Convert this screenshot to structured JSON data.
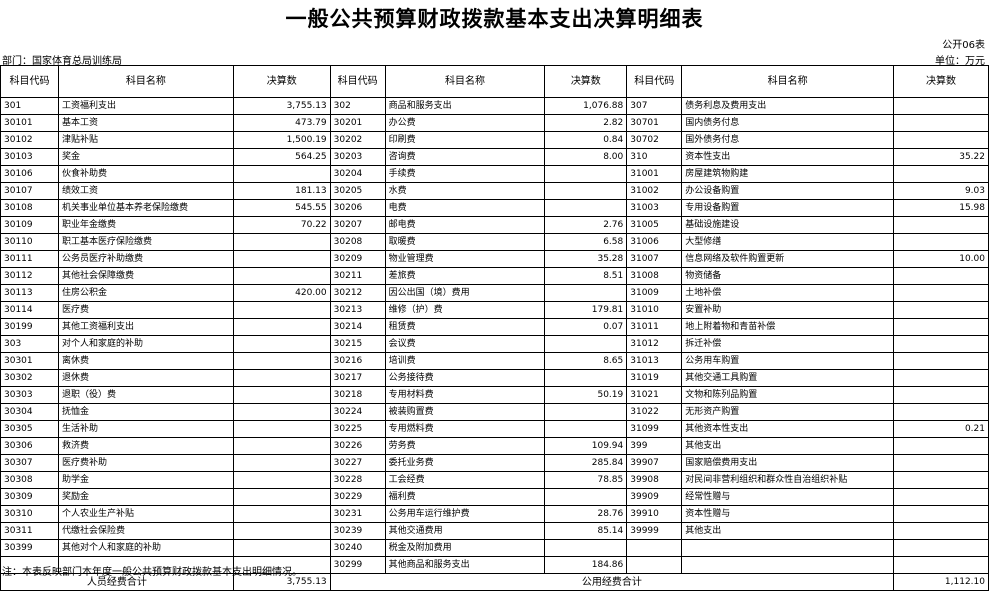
{
  "title": "一般公共预算财政拨款基本支出决算明细表",
  "table_no": "公开06表",
  "department": "部门：国家体育总局训练局",
  "unit": "单位：万元",
  "headers": {
    "code": "科目代码",
    "name": "科目名称",
    "amount": "决算数"
  },
  "rows": [
    {
      "c1": "301",
      "n1": "工资福利支出",
      "a1": "3,755.13",
      "c2": "302",
      "n2": "商品和服务支出",
      "a2": "1,076.88",
      "c3": "307",
      "n3": "债务利息及费用支出",
      "a3": ""
    },
    {
      "c1": "30101",
      "n1": "基本工资",
      "a1": "473.79",
      "c2": "30201",
      "n2": "办公费",
      "a2": "2.82",
      "c3": "30701",
      "n3": "国内债务付息",
      "a3": ""
    },
    {
      "c1": "30102",
      "n1": "津贴补贴",
      "a1": "1,500.19",
      "c2": "30202",
      "n2": "印刷费",
      "a2": "0.84",
      "c3": "30702",
      "n3": "国外债务付息",
      "a3": ""
    },
    {
      "c1": "30103",
      "n1": "奖金",
      "a1": "564.25",
      "c2": "30203",
      "n2": "咨询费",
      "a2": "8.00",
      "c3": "310",
      "n3": "资本性支出",
      "a3": "35.22"
    },
    {
      "c1": "30106",
      "n1": "伙食补助费",
      "a1": "",
      "c2": "30204",
      "n2": "手续费",
      "a2": "",
      "c3": "31001",
      "n3": "房屋建筑物购建",
      "a3": ""
    },
    {
      "c1": "30107",
      "n1": "绩效工资",
      "a1": "181.13",
      "c2": "30205",
      "n2": "水费",
      "a2": "",
      "c3": "31002",
      "n3": "办公设备购置",
      "a3": "9.03"
    },
    {
      "c1": "30108",
      "n1": "机关事业单位基本养老保险缴费",
      "a1": "545.55",
      "c2": "30206",
      "n2": "电费",
      "a2": "",
      "c3": "31003",
      "n3": "专用设备购置",
      "a3": "15.98"
    },
    {
      "c1": "30109",
      "n1": "职业年金缴费",
      "a1": "70.22",
      "c2": "30207",
      "n2": "邮电费",
      "a2": "2.76",
      "c3": "31005",
      "n3": "基础设施建设",
      "a3": ""
    },
    {
      "c1": "30110",
      "n1": "职工基本医疗保险缴费",
      "a1": "",
      "c2": "30208",
      "n2": "取暖费",
      "a2": "6.58",
      "c3": "31006",
      "n3": "大型修缮",
      "a3": ""
    },
    {
      "c1": "30111",
      "n1": "公务员医疗补助缴费",
      "a1": "",
      "c2": "30209",
      "n2": "物业管理费",
      "a2": "35.28",
      "c3": "31007",
      "n3": "信息网络及软件购置更新",
      "a3": "10.00"
    },
    {
      "c1": "30112",
      "n1": "其他社会保障缴费",
      "a1": "",
      "c2": "30211",
      "n2": "差旅费",
      "a2": "8.51",
      "c3": "31008",
      "n3": "物资储备",
      "a3": ""
    },
    {
      "c1": "30113",
      "n1": "住房公积金",
      "a1": "420.00",
      "c2": "30212",
      "n2": "因公出国（境）费用",
      "a2": "",
      "c3": "31009",
      "n3": "土地补偿",
      "a3": ""
    },
    {
      "c1": "30114",
      "n1": "医疗费",
      "a1": "",
      "c2": "30213",
      "n2": "维修（护）费",
      "a2": "179.81",
      "c3": "31010",
      "n3": "安置补助",
      "a3": ""
    },
    {
      "c1": "30199",
      "n1": "其他工资福利支出",
      "a1": "",
      "c2": "30214",
      "n2": "租赁费",
      "a2": "0.07",
      "c3": "31011",
      "n3": "地上附着物和青苗补偿",
      "a3": ""
    },
    {
      "c1": "303",
      "n1": "对个人和家庭的补助",
      "a1": "",
      "c2": "30215",
      "n2": "会议费",
      "a2": "",
      "c3": "31012",
      "n3": "拆迁补偿",
      "a3": ""
    },
    {
      "c1": "30301",
      "n1": "离休费",
      "a1": "",
      "c2": "30216",
      "n2": "培训费",
      "a2": "8.65",
      "c3": "31013",
      "n3": "公务用车购置",
      "a3": ""
    },
    {
      "c1": "30302",
      "n1": "退休费",
      "a1": "",
      "c2": "30217",
      "n2": "公务接待费",
      "a2": "",
      "c3": "31019",
      "n3": "其他交通工具购置",
      "a3": ""
    },
    {
      "c1": "30303",
      "n1": "退职（役）费",
      "a1": "",
      "c2": "30218",
      "n2": "专用材料费",
      "a2": "50.19",
      "c3": "31021",
      "n3": "文物和陈列品购置",
      "a3": ""
    },
    {
      "c1": "30304",
      "n1": "抚恤金",
      "a1": "",
      "c2": "30224",
      "n2": "被装购置费",
      "a2": "",
      "c3": "31022",
      "n3": "无形资产购置",
      "a3": ""
    },
    {
      "c1": "30305",
      "n1": "生活补助",
      "a1": "",
      "c2": "30225",
      "n2": "专用燃料费",
      "a2": "",
      "c3": "31099",
      "n3": "其他资本性支出",
      "a3": "0.21"
    },
    {
      "c1": "30306",
      "n1": "救济费",
      "a1": "",
      "c2": "30226",
      "n2": "劳务费",
      "a2": "109.94",
      "c3": "399",
      "n3": "其他支出",
      "a3": ""
    },
    {
      "c1": "30307",
      "n1": "医疗费补助",
      "a1": "",
      "c2": "30227",
      "n2": "委托业务费",
      "a2": "285.84",
      "c3": "39907",
      "n3": "国家赔偿费用支出",
      "a3": ""
    },
    {
      "c1": "30308",
      "n1": "助学金",
      "a1": "",
      "c2": "30228",
      "n2": "工会经费",
      "a2": "78.85",
      "c3": "39908",
      "n3": "对民间非营利组织和群众性自治组织补贴",
      "a3": ""
    },
    {
      "c1": "30309",
      "n1": "奖励金",
      "a1": "",
      "c2": "30229",
      "n2": "福利费",
      "a2": "",
      "c3": "39909",
      "n3": "经常性赠与",
      "a3": ""
    },
    {
      "c1": "30310",
      "n1": "个人农业生产补贴",
      "a1": "",
      "c2": "30231",
      "n2": "公务用车运行维护费",
      "a2": "28.76",
      "c3": "39910",
      "n3": "资本性赠与",
      "a3": ""
    },
    {
      "c1": "30311",
      "n1": "代缴社会保险费",
      "a1": "",
      "c2": "30239",
      "n2": "其他交通费用",
      "a2": "85.14",
      "c3": "39999",
      "n3": "其他支出",
      "a3": ""
    },
    {
      "c1": "30399",
      "n1": "其他对个人和家庭的补助",
      "a1": "",
      "c2": "30240",
      "n2": "税金及附加费用",
      "a2": "",
      "c3": "",
      "n3": "",
      "a3": ""
    },
    {
      "c1": "",
      "n1": "",
      "a1": "",
      "c2": "30299",
      "n2": "其他商品和服务支出",
      "a2": "184.86",
      "c3": "",
      "n3": "",
      "a3": ""
    }
  ],
  "totals": {
    "personnel_label": "人员经费合计",
    "personnel_value": "3,755.13",
    "public_label": "公用经费合计",
    "public_value": "1,112.10"
  },
  "note": "注：本表反映部门本年度一般公共预算财政拨款基本支出明细情况。"
}
